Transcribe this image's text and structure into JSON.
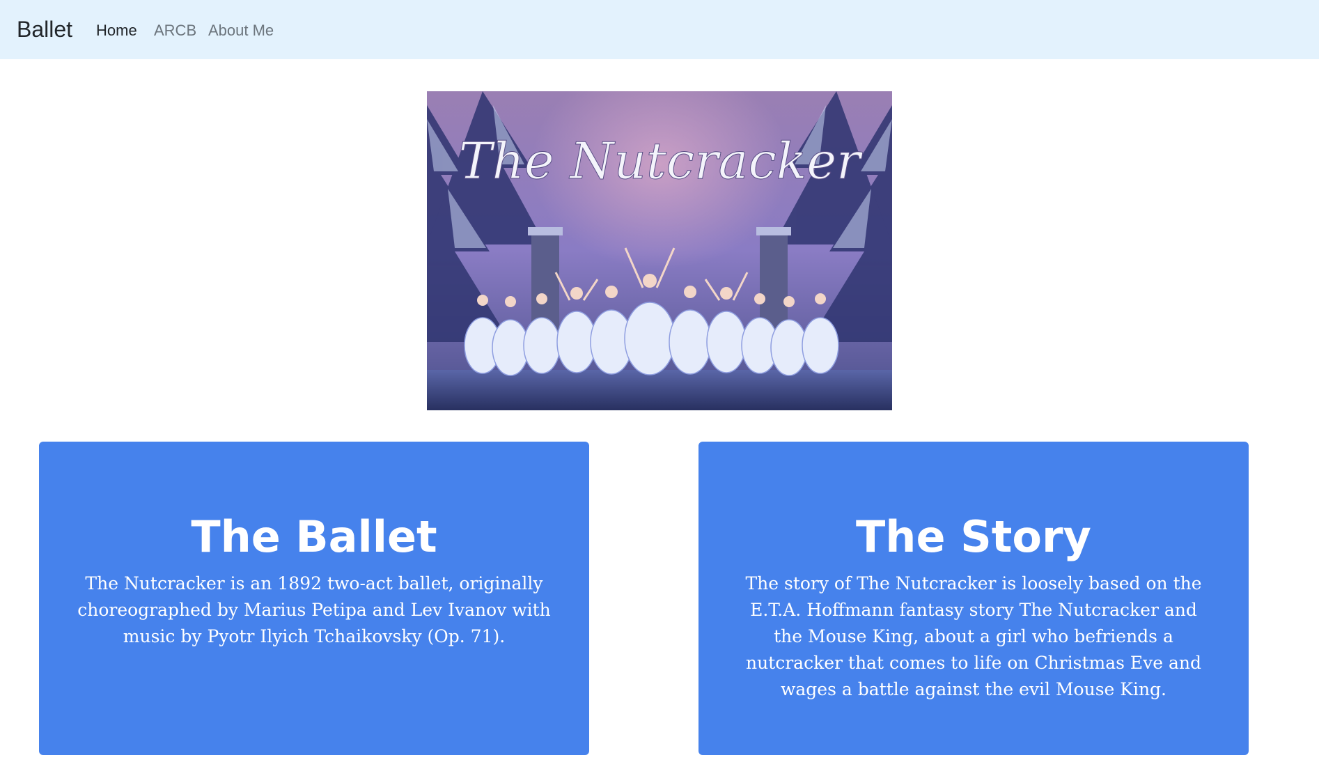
{
  "navbar": {
    "brand": "Ballet",
    "links": [
      {
        "label": "Home",
        "active": true
      },
      {
        "label": "ARCB",
        "active": false
      },
      {
        "label": "About Me",
        "active": false
      }
    ],
    "background_color": "#e3f2fd"
  },
  "hero": {
    "title": "The Nutcracker"
  },
  "cards": [
    {
      "title": "The Ballet",
      "text": "The Nutcracker is an 1892 two-act ballet, originally choreographed by Marius Petipa and Lev Ivanov with music by Pyotr Ilyich Tchaikovsky (Op. 71)."
    },
    {
      "title": "The Story",
      "text": "The story of The Nutcracker is loosely based on the E.T.A. Hoffmann fantasy story The Nutcracker and the Mouse King, about a girl who befriends a nutcracker that comes to life on Christmas Eve and wages a battle against the evil Mouse King."
    }
  ],
  "colors": {
    "card_background": "#4682ec",
    "card_text": "#ffffff"
  }
}
